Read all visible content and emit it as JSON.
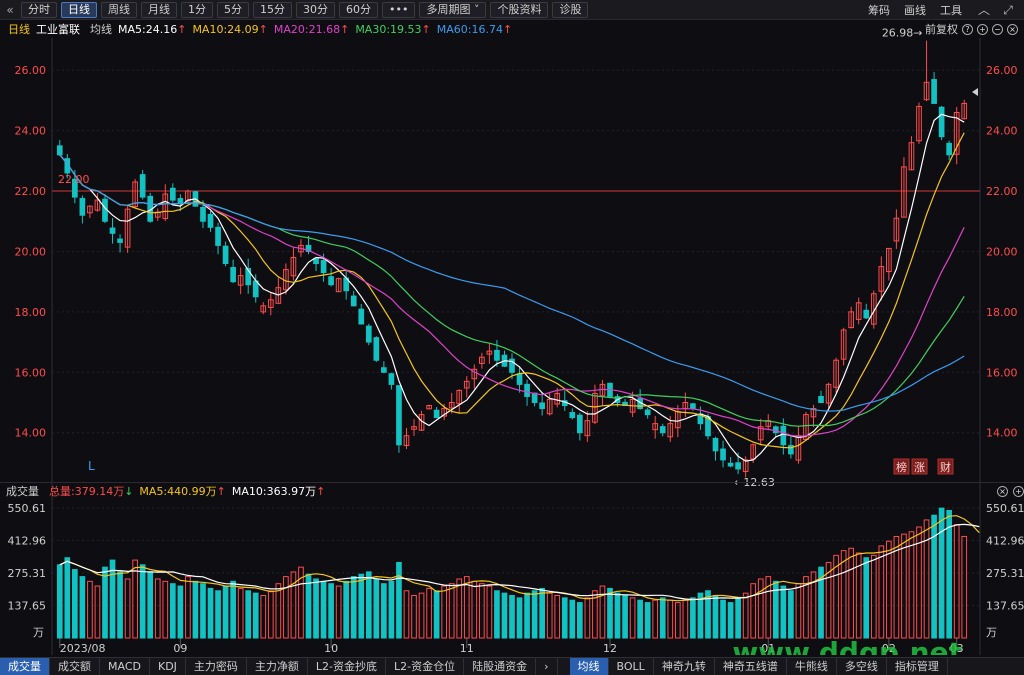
{
  "toolbar": {
    "back_icon": "chevron-left-icon",
    "buttons": [
      "分时",
      "日线",
      "周线",
      "月线",
      "1分",
      "5分",
      "15分",
      "30分",
      "60分",
      "•••",
      "多周期图",
      "个股资料",
      "诊股"
    ],
    "active": "日线",
    "dropdown_icon": "chevron-down-icon",
    "right_links": [
      "筹码",
      "画线",
      "工具"
    ],
    "right_icons": [
      "chevron-up-icon",
      "expand-icon"
    ]
  },
  "header": {
    "period": "日线",
    "stock_name": "工业富联",
    "avg_label": "均线",
    "ma": [
      {
        "label": "MA5:24.16",
        "color": "#ffffff"
      },
      {
        "label": "MA10:24.09",
        "color": "#f5c518"
      },
      {
        "label": "MA20:21.68",
        "color": "#e040c8"
      },
      {
        "label": "MA30:19.53",
        "color": "#3fcf5f"
      },
      {
        "label": "MA60:16.74",
        "color": "#3a9cf0"
      }
    ],
    "up_arrow": "↑",
    "adjust_label": "前复权",
    "adjust_icons": [
      "help-icon",
      "add-icon",
      "zoom-out-icon",
      "close-icon"
    ]
  },
  "volume_header": {
    "title": "成交量",
    "total": "总量:379.14万",
    "total_arrow": "↓",
    "ma5": "MA5:440.99万",
    "ma5_arrow": "↑",
    "ma10": "MA10:363.97万",
    "ma10_arrow": "↑",
    "icons": [
      "close-icon",
      "add-icon"
    ]
  },
  "price_axis": {
    "ticks": [
      "26.00",
      "24.00",
      "22.00",
      "20.00",
      "18.00",
      "16.00",
      "14.00"
    ]
  },
  "volume_axis": {
    "ticks": [
      "550.61",
      "412.96",
      "275.31",
      "137.65"
    ],
    "unit": "万"
  },
  "date_axis": [
    "2023/08",
    "09",
    "10",
    "11",
    "12",
    "01",
    "02",
    "03"
  ],
  "annotations": {
    "high": "26.98→",
    "low": "←12.63",
    "ref_price": "22.00",
    "marker_L": "L",
    "badges": [
      "榜",
      "涨",
      "财"
    ]
  },
  "bottom_tabs": [
    "成交量",
    "成交额",
    "MACD",
    "KDJ",
    "主力密码",
    "主力净额",
    "L2-资金抄底",
    "L2-资金仓位",
    "陆股通资金",
    "›",
    "均线",
    "BOLL",
    "神奇九转",
    "神奇五线谱",
    "牛熊线",
    "多空线",
    "指标管理"
  ],
  "bottom_active": [
    "成交量",
    "均线"
  ],
  "watermark": "www.ddgp.net",
  "colors": {
    "up": "#ff4b4b",
    "down": "#13c2c2",
    "ma5": "#ffffff",
    "ma10": "#f5c518",
    "ma20": "#e040c8",
    "ma30": "#3fcf5f",
    "ma60": "#3a9cf0",
    "ref_line": "#d03838"
  },
  "chart_data": {
    "type": "candlestick",
    "ylim": [
      12.6,
      27.0
    ],
    "volume_ylim": [
      0,
      550.61
    ],
    "closes": [
      23.2,
      22.6,
      21.8,
      21.2,
      21.5,
      21.7,
      21.0,
      20.6,
      20.3,
      21.4,
      22.3,
      21.8,
      21.0,
      21.3,
      21.9,
      21.7,
      21.6,
      22.0,
      21.5,
      21.0,
      20.8,
      20.2,
      19.6,
      19.0,
      19.2,
      18.9,
      18.5,
      18.2,
      18.4,
      18.8,
      19.4,
      19.8,
      20.2,
      20.0,
      19.6,
      19.3,
      18.9,
      19.1,
      18.7,
      18.2,
      17.6,
      17.0,
      16.4,
      16.0,
      15.6,
      13.6,
      13.9,
      14.2,
      14.6,
      14.9,
      14.5,
      14.8,
      15.0,
      15.4,
      15.7,
      16.1,
      16.5,
      16.7,
      16.4,
      16.2,
      16.0,
      15.6,
      15.2,
      15.0,
      14.8,
      15.1,
      15.3,
      14.9,
      14.5,
      14.0,
      14.4,
      15.3,
      15.6,
      15.2,
      15.0,
      14.9,
      15.1,
      14.8,
      14.6,
      14.3,
      14.0,
      14.3,
      14.7,
      15.0,
      14.8,
      14.3,
      13.9,
      13.4,
      13.1,
      12.9,
      12.8,
      13.1,
      13.6,
      14.2,
      14.4,
      14.0,
      13.6,
      13.3,
      13.9,
      14.6,
      14.8,
      15.0,
      15.6,
      16.4,
      17.4,
      18.0,
      18.3,
      17.8,
      18.6,
      19.5,
      20.1,
      21.1,
      22.8,
      23.6,
      24.8,
      25.6,
      24.9,
      23.8,
      23.2,
      24.6,
      24.9
    ],
    "volumes": [
      310,
      340,
      290,
      260,
      240,
      220,
      300,
      330,
      280,
      250,
      330,
      310,
      280,
      250,
      240,
      230,
      220,
      260,
      240,
      230,
      210,
      200,
      220,
      240,
      210,
      200,
      190,
      180,
      200,
      230,
      260,
      280,
      300,
      270,
      250,
      240,
      230,
      220,
      240,
      260,
      270,
      280,
      250,
      230,
      240,
      320,
      200,
      180,
      190,
      210,
      200,
      220,
      230,
      250,
      260,
      240,
      230,
      220,
      200,
      190,
      180,
      170,
      190,
      200,
      210,
      190,
      180,
      170,
      160,
      150,
      170,
      200,
      220,
      210,
      190,
      180,
      170,
      160,
      150,
      160,
      170,
      160,
      150,
      160,
      170,
      190,
      200,
      180,
      160,
      150,
      170,
      190,
      230,
      250,
      260,
      240,
      220,
      200,
      230,
      260,
      280,
      300,
      320,
      350,
      370,
      380,
      360,
      340,
      350,
      390,
      410,
      430,
      440,
      450,
      470,
      500,
      520,
      550,
      540,
      480,
      430,
      400,
      380
    ],
    "ma5": [
      24.16
    ],
    "ma10": [
      24.09
    ],
    "ma20": [
      21.68
    ],
    "ma30": [
      19.53
    ],
    "ma60": [
      16.74
    ],
    "high_label": 26.98,
    "low_label": 12.63,
    "xlabels": [
      "2023/08",
      "09",
      "10",
      "11",
      "12",
      "01",
      "02",
      "03"
    ]
  }
}
